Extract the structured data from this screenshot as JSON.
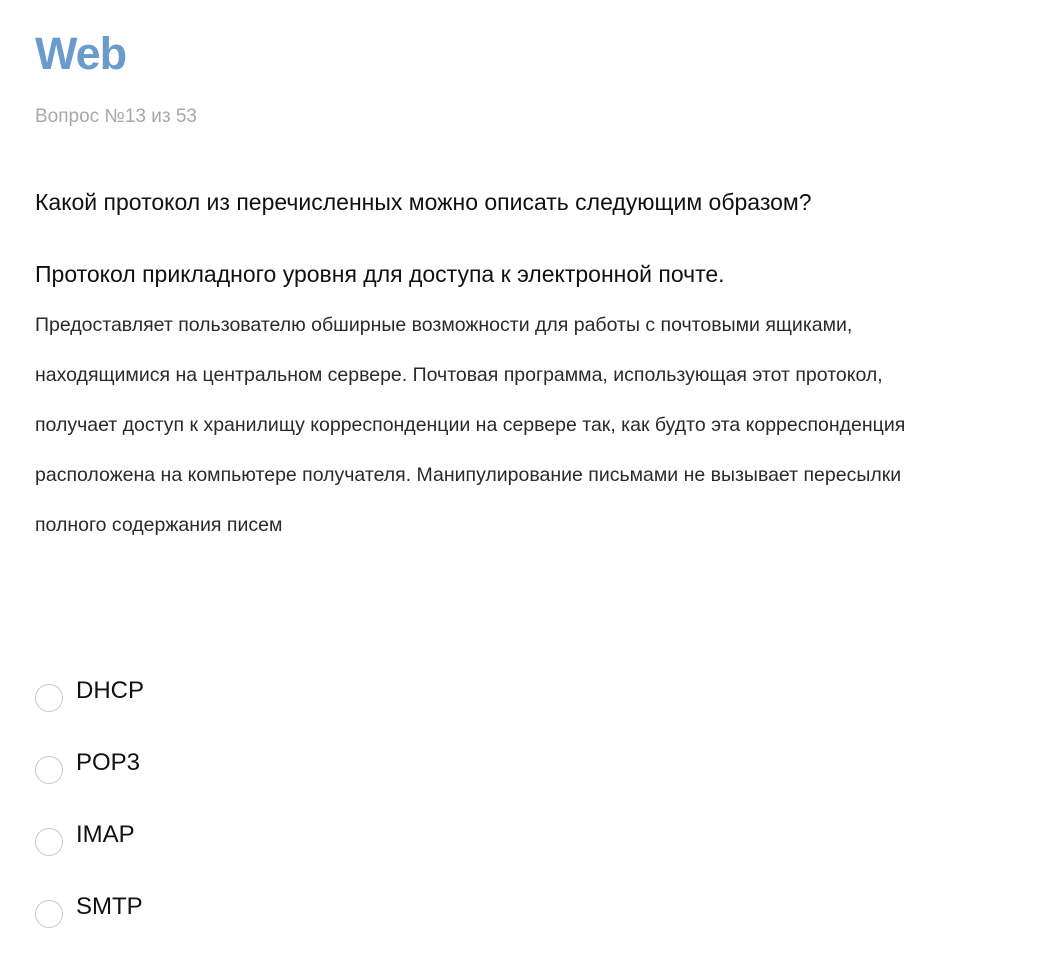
{
  "header": {
    "title": "Web",
    "counter": "Вопрос №13 из 53"
  },
  "question": {
    "text": "Какой протокол из перечисленных можно описать следующим образом?",
    "subheading": "Протокол прикладного уровня для доступа к электронной почте.",
    "description": "Предоставляет пользователю обширные возможности для работы с почтовыми ящиками, находящимися на центральном сервере. Почтовая программа, использующая этот протокол, получает доступ к хранилищу корреспонденции на сервере так, как будто эта корреспонденция расположена на компьютере получателя. Манипулирование письмами не вызывает пересылки полного содержания писем"
  },
  "options": [
    {
      "label": "DHCP",
      "selected": false
    },
    {
      "label": "POP3",
      "selected": false
    },
    {
      "label": "IMAP",
      "selected": false
    },
    {
      "label": "SMTP",
      "selected": false
    }
  ],
  "colors": {
    "accent": "#6b9bcc",
    "muted": "#a8a8a8",
    "radio_border": "#c9c9c9"
  }
}
